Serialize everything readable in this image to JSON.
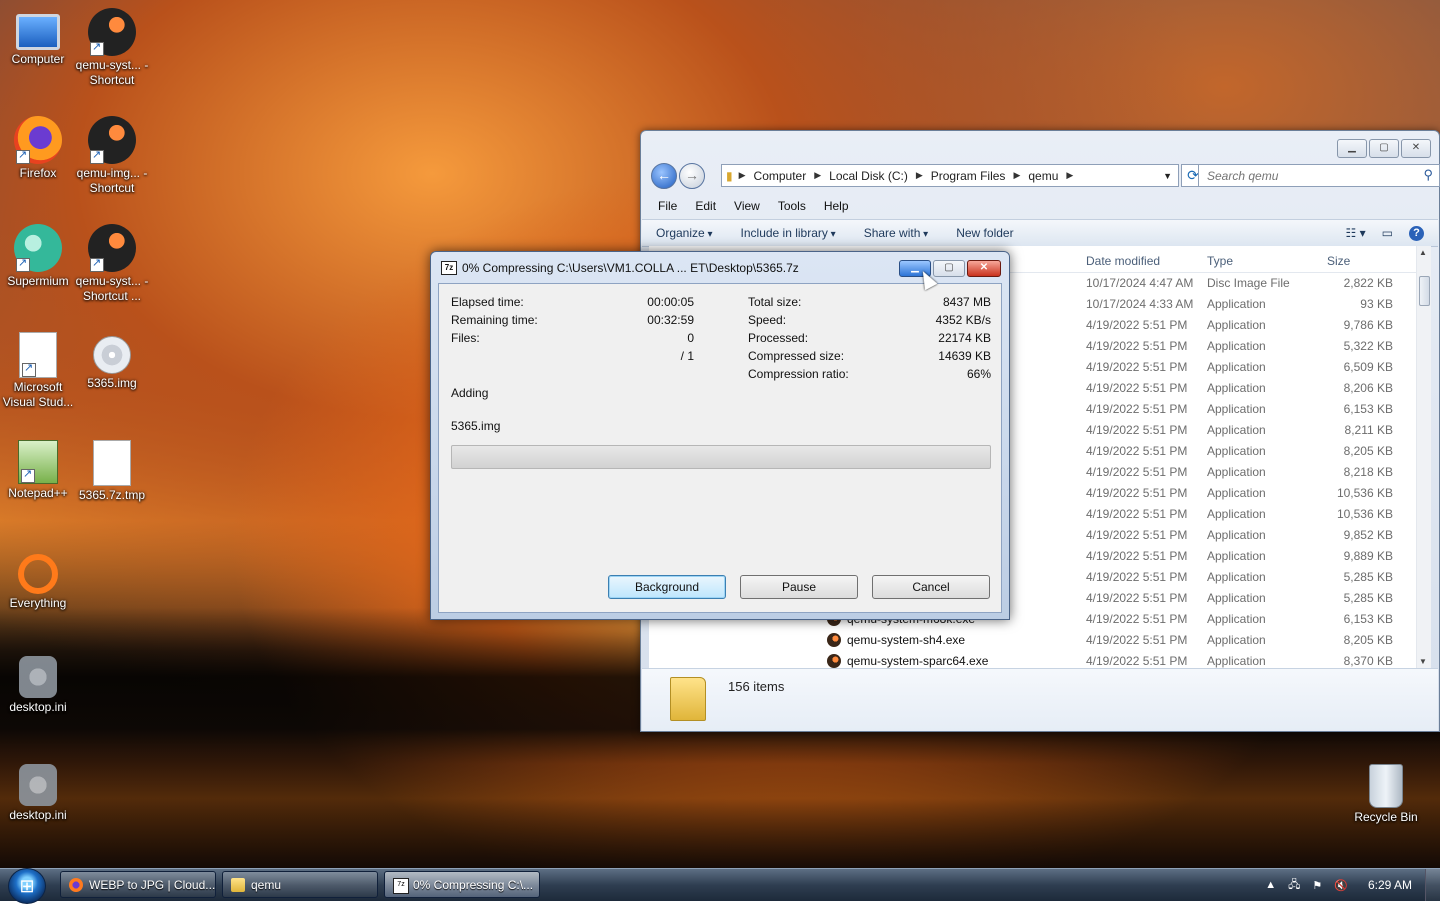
{
  "desktop": {
    "icons": [
      {
        "label": "Computer",
        "icon": "computer-icon"
      },
      {
        "label": "qemu-syst... - Shortcut",
        "icon": "qemu-icon"
      },
      {
        "label": "Firefox",
        "icon": "firefox-icon"
      },
      {
        "label": "qemu-img... - Shortcut",
        "icon": "qemu-icon"
      },
      {
        "label": "Supermium",
        "icon": "supermium-icon"
      },
      {
        "label": "qemu-syst... - Shortcut ...",
        "icon": "qemu-icon"
      },
      {
        "label": "Microsoft Visual Stud...",
        "icon": "visual-studio-icon"
      },
      {
        "label": "5365.img",
        "icon": "disc-image-icon"
      },
      {
        "label": "Notepad++",
        "icon": "notepad-plus-plus-icon"
      },
      {
        "label": "5365.7z.tmp",
        "icon": "file-icon"
      },
      {
        "label": "Everything",
        "icon": "everything-icon"
      },
      {
        "label": "desktop.ini",
        "icon": "settings-file-icon"
      },
      {
        "label": "desktop.ini",
        "icon": "settings-file-icon"
      },
      {
        "label": "Recycle Bin",
        "icon": "recycle-bin-icon"
      }
    ]
  },
  "explorer": {
    "address": [
      "Computer",
      "Local Disk (C:)",
      "Program Files",
      "qemu"
    ],
    "search_placeholder": "Search qemu",
    "menu": [
      "File",
      "Edit",
      "View",
      "Tools",
      "Help"
    ],
    "commands": {
      "organize": "Organize",
      "include": "Include in library",
      "share": "Share with",
      "new_folder": "New folder"
    },
    "columns": {
      "date": "Date modified",
      "type": "Type",
      "size": "Size"
    },
    "rows": [
      {
        "name": "",
        "date": "10/17/2024 4:47 AM",
        "type": "Disc Image File",
        "size": "2,822 KB"
      },
      {
        "name": "",
        "date": "10/17/2024 4:33 AM",
        "type": "Application",
        "size": "93 KB"
      },
      {
        "name": "",
        "date": "4/19/2022 5:51 PM",
        "type": "Application",
        "size": "9,786 KB"
      },
      {
        "name": "",
        "date": "4/19/2022 5:51 PM",
        "type": "Application",
        "size": "5,322 KB"
      },
      {
        "name": "",
        "date": "4/19/2022 5:51 PM",
        "type": "Application",
        "size": "6,509 KB"
      },
      {
        "name": "",
        "date": "4/19/2022 5:51 PM",
        "type": "Application",
        "size": "8,206 KB"
      },
      {
        "name": "",
        "date": "4/19/2022 5:51 PM",
        "type": "Application",
        "size": "6,153 KB"
      },
      {
        "name": "",
        "date": "4/19/2022 5:51 PM",
        "type": "Application",
        "size": "8,211 KB"
      },
      {
        "name": "",
        "date": "4/19/2022 5:51 PM",
        "type": "Application",
        "size": "8,205 KB"
      },
      {
        "name": "",
        "date": "4/19/2022 5:51 PM",
        "type": "Application",
        "size": "8,218 KB"
      },
      {
        "name": "",
        "date": "4/19/2022 5:51 PM",
        "type": "Application",
        "size": "10,536 KB"
      },
      {
        "name": "",
        "date": "4/19/2022 5:51 PM",
        "type": "Application",
        "size": "10,536 KB"
      },
      {
        "name": "",
        "date": "4/19/2022 5:51 PM",
        "type": "Application",
        "size": "9,852 KB"
      },
      {
        "name": "",
        "date": "4/19/2022 5:51 PM",
        "type": "Application",
        "size": "9,889 KB"
      },
      {
        "name": "",
        "date": "4/19/2022 5:51 PM",
        "type": "Application",
        "size": "5,285 KB"
      },
      {
        "name": "",
        "date": "4/19/2022 5:51 PM",
        "type": "Application",
        "size": "5,285 KB"
      },
      {
        "name": "qemu-system-m68k.exe",
        "date": "4/19/2022 5:51 PM",
        "type": "Application",
        "size": "6,153 KB"
      },
      {
        "name": "qemu-system-sh4.exe",
        "date": "4/19/2022 5:51 PM",
        "type": "Application",
        "size": "8,205 KB"
      },
      {
        "name": "qemu-system-sparc64.exe",
        "date": "4/19/2022 5:51 PM",
        "type": "Application",
        "size": "8,370 KB"
      }
    ],
    "status": "156 items"
  },
  "zip": {
    "title": "0% Compressing C:\\Users\\VM1.COLLA ... ET\\Desktop\\5365.7z",
    "labels": {
      "elapsed": "Elapsed time:",
      "remaining": "Remaining time:",
      "files": "Files:",
      "total": "Total size:",
      "speed": "Speed:",
      "processed": "Processed:",
      "compressed": "Compressed size:",
      "ratio": "Compression ratio:"
    },
    "values": {
      "elapsed": "00:00:05",
      "remaining": "00:32:59",
      "files": "0",
      "files_total": "/ 1",
      "total": "8437 MB",
      "speed": "4352 KB/s",
      "processed": "22174 KB",
      "compressed": "14639 KB",
      "ratio": "66%"
    },
    "status": "Adding",
    "current_file": "5365.img",
    "progress_percent": 0,
    "buttons": {
      "background": "Background",
      "pause": "Pause",
      "cancel": "Cancel"
    }
  },
  "taskbar": {
    "items": [
      {
        "label": "WEBP to JPG | Cloud...",
        "icon": "firefox-icon"
      },
      {
        "label": "qemu",
        "icon": "folder-icon"
      },
      {
        "label": "0% Compressing C:\\...",
        "icon": "7zip-icon"
      }
    ],
    "clock": "6:29 AM"
  }
}
